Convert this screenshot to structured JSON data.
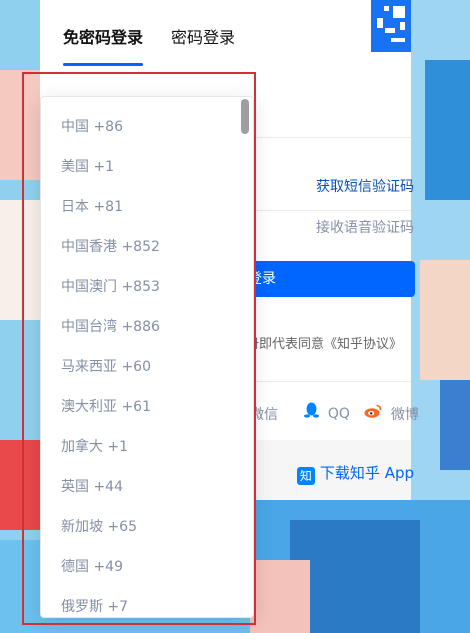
{
  "tabs": {
    "passwordless": "免密码登录",
    "password": "密码登录"
  },
  "links": {
    "sms_code": "获取短信验证码",
    "voice_code": "接收语音验证码"
  },
  "login_button": "登录",
  "agreement": "册即代表同意《知乎协议》",
  "social": {
    "wechat": "微信",
    "qq": "QQ",
    "weibo": "微博"
  },
  "app_download": {
    "logo": "知",
    "label": "下载知乎 App"
  },
  "dropdown": {
    "items": [
      {
        "label": "中国 +86"
      },
      {
        "label": "美国 +1"
      },
      {
        "label": "日本 +81"
      },
      {
        "label": "中国香港 +852"
      },
      {
        "label": "中国澳门 +853"
      },
      {
        "label": "中国台湾 +886"
      },
      {
        "label": "马来西亚 +60"
      },
      {
        "label": "澳大利亚 +61"
      },
      {
        "label": "加拿大 +1"
      },
      {
        "label": "英国 +44"
      },
      {
        "label": "新加坡 +65"
      },
      {
        "label": "德国 +49"
      },
      {
        "label": "俄罗斯 +7"
      }
    ]
  },
  "colors": {
    "accent": "#0066ff",
    "link": "#0a4fb8",
    "muted": "#8590a6",
    "highlight_outline": "#d0303a"
  },
  "icons": [
    "qr-code-icon",
    "qq-icon",
    "weibo-icon",
    "zhihu-logo-icon"
  ]
}
